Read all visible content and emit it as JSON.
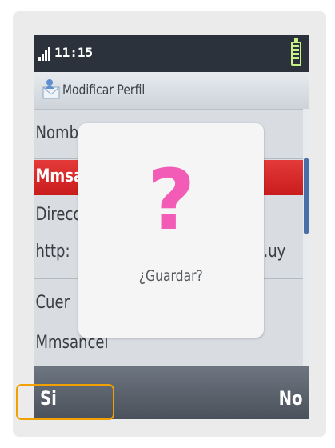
{
  "status_bar": {
    "time": "11:15",
    "signal_icon": "signal-bars-icon",
    "battery_icon": "battery-icon"
  },
  "title_bar": {
    "title": "Modificar Perfil",
    "icon": "profile-envelope-icon"
  },
  "list": {
    "rows": [
      {
        "text": "Nombre perfil"
      },
      {
        "text": "Mmsancel"
      },
      {
        "text": "Direcci"
      },
      {
        "text": "http:"
      },
      {
        "text": ".uy"
      },
      {
        "text": "Cuer"
      },
      {
        "text": "Mmsancel"
      }
    ],
    "selected_color": "#d42a2a"
  },
  "dialog": {
    "icon": "question-mark-icon",
    "symbol": "?",
    "message": "¿Guardar?",
    "symbol_color": "#f25cb6"
  },
  "softkeys": {
    "left": "Si",
    "right": "No"
  },
  "highlight_color": "#f0a000"
}
